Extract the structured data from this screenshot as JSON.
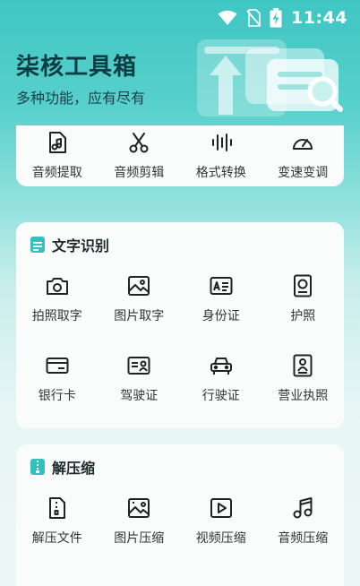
{
  "status_bar": {
    "time": "11:44"
  },
  "hero": {
    "title": "柒核工具箱",
    "subtitle": "多种功能，应有尽有"
  },
  "audio_tools": {
    "items": [
      {
        "label": "音频提取",
        "icon": "music-file-icon"
      },
      {
        "label": "音频剪辑",
        "icon": "scissors-icon"
      },
      {
        "label": "格式转换",
        "icon": "audio-wave-icon"
      },
      {
        "label": "变速变调",
        "icon": "speedometer-icon"
      }
    ]
  },
  "ocr": {
    "title": "文字识别",
    "items": [
      {
        "label": "拍照取字",
        "icon": "camera-icon"
      },
      {
        "label": "图片取字",
        "icon": "image-icon"
      },
      {
        "label": "身份证",
        "icon": "id-card-icon"
      },
      {
        "label": "护照",
        "icon": "passport-icon"
      },
      {
        "label": "银行卡",
        "icon": "bank-card-icon"
      },
      {
        "label": "驾驶证",
        "icon": "driver-license-icon"
      },
      {
        "label": "行驶证",
        "icon": "car-icon"
      },
      {
        "label": "营业执照",
        "icon": "business-license-icon"
      }
    ]
  },
  "zip": {
    "title": "解压缩",
    "items": [
      {
        "label": "解压文件",
        "icon": "zip-file-icon"
      },
      {
        "label": "图片压缩",
        "icon": "image-compress-icon"
      },
      {
        "label": "视频压缩",
        "icon": "video-compress-icon"
      },
      {
        "label": "音频压缩",
        "icon": "music-note-icon"
      }
    ]
  },
  "colors": {
    "accent": "#34c0bd",
    "icon_stroke": "#222222",
    "title": "#0f3b43"
  }
}
